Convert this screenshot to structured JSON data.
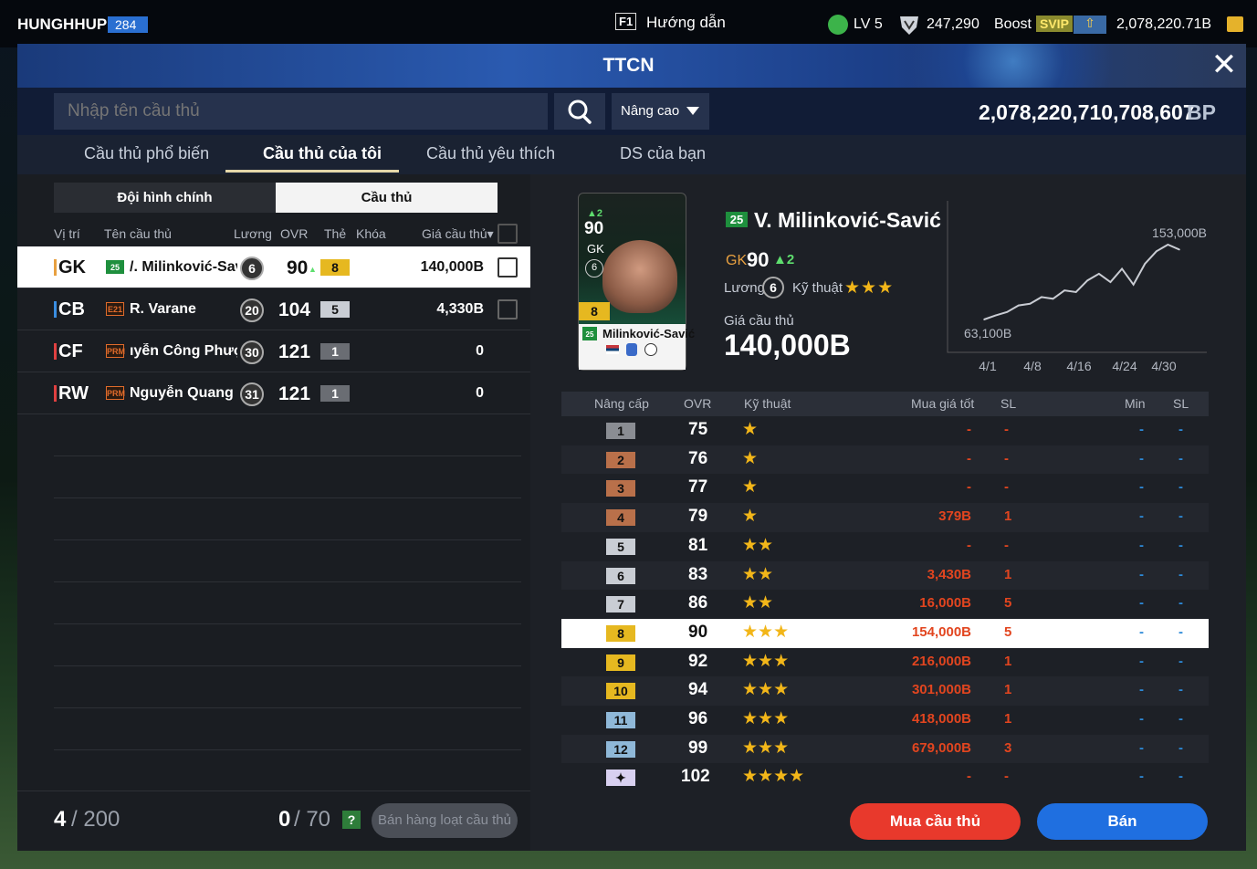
{
  "topbar": {
    "username": "HUNGHHUPF",
    "user_level": "284",
    "help_key": "F1",
    "help_label": "Hướng dẫn",
    "level_label": "LV 5",
    "currency1": "247,290",
    "boost_label": "Boost",
    "svip_label": "SVIP",
    "balance": "2,078,220.71B"
  },
  "window": {
    "title": "TTCN"
  },
  "search": {
    "placeholder": "Nhập tên cầu thủ",
    "advanced_label": "Nâng cao",
    "bp_value": "2,078,220,710,708,607",
    "bp_unit": "BP"
  },
  "tabs": [
    {
      "label": "Cầu thủ phổ biến"
    },
    {
      "label": "Cầu thủ của tôi",
      "active": true
    },
    {
      "label": "Cầu thủ yêu thích"
    },
    {
      "label": "DS của bạn"
    }
  ],
  "segments": {
    "lineup": "Đội hình chính",
    "players": "Cầu thủ"
  },
  "list_headers": {
    "position": "Vị trí",
    "name": "Tên cầu thủ",
    "wage": "Lương",
    "ovr": "OVR",
    "card": "Thẻ",
    "lock": "Khóa",
    "price": "Giá cầu thủ"
  },
  "players": [
    {
      "pos": "GK",
      "season": "25",
      "name": "/. Milinković-Savi",
      "wage": "6",
      "ovr": "90",
      "level": "8",
      "price": "140,000B"
    },
    {
      "pos": "CB",
      "season": "E21",
      "name": "R. Varane",
      "wage": "20",
      "ovr": "104",
      "level": "5",
      "price": "4,330B"
    },
    {
      "pos": "CF",
      "season": "PRM",
      "name": "ıyễn Công Phượng",
      "wage": "30",
      "ovr": "121",
      "level": "1",
      "price": "0"
    },
    {
      "pos": "RW",
      "season": "PRM",
      "name": "Nguyễn Quang Hả",
      "wage": "31",
      "ovr": "121",
      "level": "1",
      "price": "0"
    }
  ],
  "footer": {
    "count": "4",
    "count_max": "/ 200",
    "sale_count": "0",
    "sale_max": "/ 70",
    "help": "?",
    "bulk_sell": "Bán hàng loạt cầu thủ"
  },
  "detail": {
    "card": {
      "ovr": "90",
      "up": "▲2",
      "pos": "GK",
      "wage": "6",
      "level": "8",
      "season": "25",
      "name": "Milinković-Savić"
    },
    "season": "25",
    "name": "V. Milinković-Savić",
    "pos": "GK",
    "ovr": "90",
    "ovr_up": "▲2",
    "wage_label": "Lương",
    "wage": "6",
    "skill_label": "Kỹ thuật",
    "skill_stars": "★★★",
    "price_label": "Giá cầu thủ",
    "price": "140,000B"
  },
  "chart_data": {
    "type": "line",
    "x": [
      "4/1",
      "4/3",
      "4/5",
      "4/7",
      "4/8",
      "4/10",
      "4/12",
      "4/14",
      "4/16",
      "4/17",
      "4/18",
      "4/20",
      "4/22",
      "4/24",
      "4/26",
      "4/28",
      "4/29",
      "4/30"
    ],
    "values": [
      63100,
      68000,
      72000,
      80000,
      82000,
      90000,
      88000,
      98000,
      96000,
      110000,
      118000,
      108000,
      124000,
      105000,
      130000,
      145000,
      153000,
      147000
    ],
    "max_label": "153,000B",
    "min_label": "63,100B",
    "xticks": [
      "4/1",
      "4/8",
      "4/16",
      "4/24",
      "4/30"
    ],
    "color": "#c9ccd3"
  },
  "upgrade_headers": {
    "level": "Nâng cấp",
    "ovr": "OVR",
    "skill": "Kỹ thuật",
    "best_buy": "Mua giá tốt",
    "sl": "SL",
    "min": "Min",
    "sl2": "SL"
  },
  "upgrades": [
    {
      "lv": "1",
      "ovr": "75",
      "stars": "★",
      "price": "-",
      "sl": "-",
      "min": "-",
      "sl2": "-",
      "color": "#8a8d93"
    },
    {
      "lv": "2",
      "ovr": "76",
      "stars": "★",
      "price": "-",
      "sl": "-",
      "min": "-",
      "sl2": "-",
      "color": "#b9704a"
    },
    {
      "lv": "3",
      "ovr": "77",
      "stars": "★",
      "price": "-",
      "sl": "-",
      "min": "-",
      "sl2": "-",
      "color": "#b9704a"
    },
    {
      "lv": "4",
      "ovr": "79",
      "stars": "★",
      "price": "379B",
      "sl": "1",
      "min": "-",
      "sl2": "-",
      "color": "#b9704a"
    },
    {
      "lv": "5",
      "ovr": "81",
      "stars": "★★",
      "price": "-",
      "sl": "-",
      "min": "-",
      "sl2": "-",
      "color": "#c9cdd4"
    },
    {
      "lv": "6",
      "ovr": "83",
      "stars": "★★",
      "price": "3,430B",
      "sl": "1",
      "min": "-",
      "sl2": "-",
      "color": "#c9cdd4"
    },
    {
      "lv": "7",
      "ovr": "86",
      "stars": "★★",
      "price": "16,000B",
      "sl": "5",
      "min": "-",
      "sl2": "-",
      "color": "#c9cdd4"
    },
    {
      "lv": "8",
      "ovr": "90",
      "stars": "★★★",
      "price": "154,000B",
      "sl": "5",
      "min": "-",
      "sl2": "-",
      "color": "#e6b820"
    },
    {
      "lv": "9",
      "ovr": "92",
      "stars": "★★★",
      "price": "216,000B",
      "sl": "1",
      "min": "-",
      "sl2": "-",
      "color": "#e6b820"
    },
    {
      "lv": "10",
      "ovr": "94",
      "stars": "★★★",
      "price": "301,000B",
      "sl": "1",
      "min": "-",
      "sl2": "-",
      "color": "#e6b820"
    },
    {
      "lv": "11",
      "ovr": "96",
      "stars": "★★★",
      "price": "418,000B",
      "sl": "1",
      "min": "-",
      "sl2": "-",
      "color": "#8fb8d8"
    },
    {
      "lv": "12",
      "ovr": "99",
      "stars": "★★★",
      "price": "679,000B",
      "sl": "3",
      "min": "-",
      "sl2": "-",
      "color": "#8fb8d8"
    },
    {
      "lv": "✦",
      "ovr": "102",
      "stars": "★★★★",
      "price": "-",
      "sl": "-",
      "min": "-",
      "sl2": "-",
      "color": "#d8d0f0"
    }
  ],
  "actions": {
    "buy": "Mua cầu thủ",
    "sell": "Bán"
  }
}
